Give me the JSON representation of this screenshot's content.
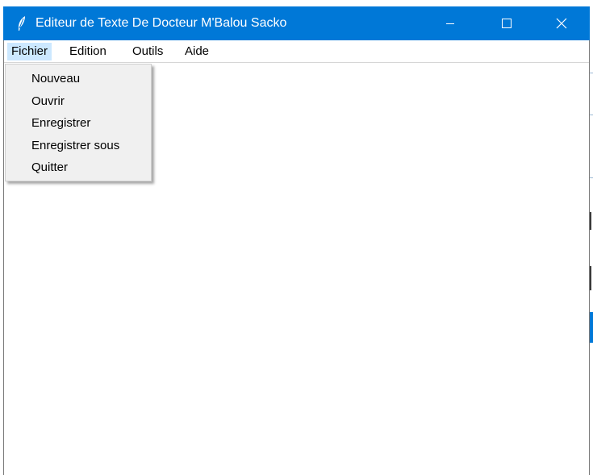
{
  "window": {
    "title": "Editeur de Texte De Docteur M'Balou Sacko",
    "titlebar_color": "#0078d7",
    "icons": {
      "app": "feather-icon",
      "minimize": "minimize-icon",
      "maximize": "maximize-icon",
      "close": "close-icon"
    }
  },
  "menubar": {
    "items": [
      {
        "label": "Fichier",
        "active": true
      },
      {
        "label": "Edition",
        "active": false
      },
      {
        "label": "Outils",
        "active": false
      },
      {
        "label": "Aide",
        "active": false
      }
    ],
    "active_color": "#cce8ff"
  },
  "file_menu": {
    "items": [
      {
        "label": "Nouveau"
      },
      {
        "label": "Ouvrir"
      },
      {
        "label": "Enregistrer"
      },
      {
        "label": "Enregistrer sous"
      },
      {
        "label": "Quitter"
      }
    ]
  },
  "editor": {
    "content": ""
  }
}
